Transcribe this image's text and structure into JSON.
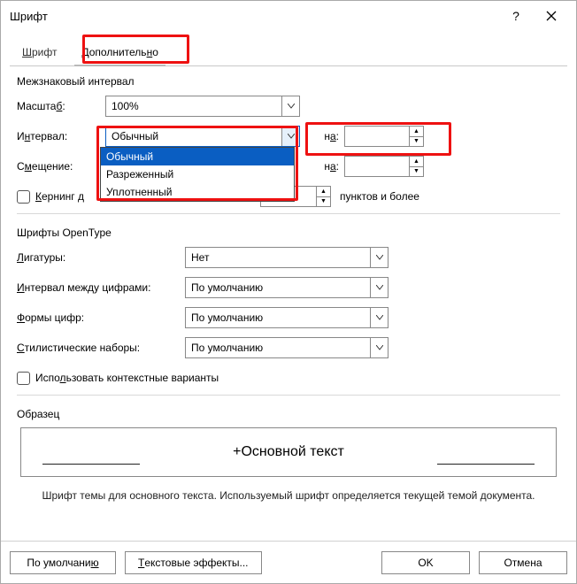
{
  "title": "Шрифт",
  "help_symbol": "?",
  "tabs": {
    "font": "Шрифт",
    "advanced": "Дополнительно"
  },
  "spacing": {
    "title": "Межзнаковый интервал",
    "scale_label": "Масштаб:",
    "scale_value": "100%",
    "interval_label": "Интервал:",
    "interval_value": "Обычный",
    "interval_by_label": "на:",
    "interval_by_value": "",
    "offset_label": "Смещение:",
    "offset_by_label": "на:",
    "offset_by_value": "",
    "kerning_label": "Кернинг д",
    "kerning_value": "",
    "kerning_suffix": "пунктов и более"
  },
  "interval_options": {
    "normal": "Обычный",
    "expanded": "Разреженный",
    "condensed": "Уплотненный"
  },
  "opentype": {
    "title": "Шрифты OpenType",
    "ligatures_label": "Лигатуры:",
    "ligatures_value": "Нет",
    "numspacing_label": "Интервал между цифрами:",
    "numspacing_value": "По умолчанию",
    "numforms_label": "Формы цифр:",
    "numforms_value": "По умолчанию",
    "stylistic_label": "Стилистические наборы:",
    "stylistic_value": "По умолчанию",
    "contextual_label": "Использовать контекстные варианты"
  },
  "preview": {
    "title": "Образец",
    "text": "+Основной текст",
    "note": "Шрифт темы для основного текста. Используемый шрифт определяется текущей темой документа."
  },
  "buttons": {
    "default": "По умолчанию",
    "text_effects": "Текстовые эффекты...",
    "ok": "OK",
    "cancel": "Отмена"
  }
}
